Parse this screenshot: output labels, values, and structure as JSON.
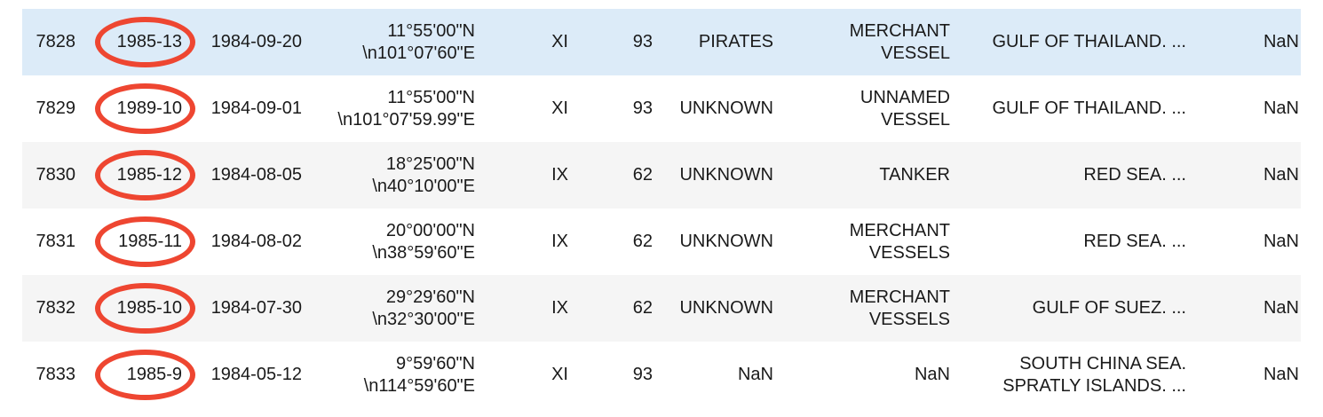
{
  "table": {
    "rows": [
      {
        "index": "7828",
        "reference": "1985-13",
        "date": "1984-09-20",
        "coord_lat": "11°55'00\"N",
        "coord_lon": "\\n101°07'60\"E",
        "subreg": "XI",
        "navarea": "93",
        "aggressor": "PIRATES",
        "victim_line1": "MERCHANT",
        "victim_line2": "VESSEL",
        "location_line1": "GULF OF THAILAND. ...",
        "location_line2": "",
        "last": "NaN"
      },
      {
        "index": "7829",
        "reference": "1989-10",
        "date": "1984-09-01",
        "coord_lat": "11°55'00\"N",
        "coord_lon": "\\n101°07'59.99\"E",
        "subreg": "XI",
        "navarea": "93",
        "aggressor": "UNKNOWN",
        "victim_line1": "UNNAMED",
        "victim_line2": "VESSEL",
        "location_line1": "GULF OF THAILAND. ...",
        "location_line2": "",
        "last": "NaN"
      },
      {
        "index": "7830",
        "reference": "1985-12",
        "date": "1984-08-05",
        "coord_lat": "18°25'00\"N",
        "coord_lon": "\\n40°10'00\"E",
        "subreg": "IX",
        "navarea": "62",
        "aggressor": "UNKNOWN",
        "victim_line1": "TANKER",
        "victim_line2": "",
        "location_line1": "RED SEA. ...",
        "location_line2": "",
        "last": "NaN"
      },
      {
        "index": "7831",
        "reference": "1985-11",
        "date": "1984-08-02",
        "coord_lat": "20°00'00\"N",
        "coord_lon": "\\n38°59'60\"E",
        "subreg": "IX",
        "navarea": "62",
        "aggressor": "UNKNOWN",
        "victim_line1": "MERCHANT",
        "victim_line2": "VESSELS",
        "location_line1": "RED SEA. ...",
        "location_line2": "",
        "last": "NaN"
      },
      {
        "index": "7832",
        "reference": "1985-10",
        "date": "1984-07-30",
        "coord_lat": "29°29'60\"N",
        "coord_lon": "\\n32°30'00\"E",
        "subreg": "IX",
        "navarea": "62",
        "aggressor": "UNKNOWN",
        "victim_line1": "MERCHANT",
        "victim_line2": "VESSELS",
        "location_line1": "GULF OF SUEZ. ...",
        "location_line2": "",
        "last": "NaN"
      },
      {
        "index": "7833",
        "reference": "1985-9",
        "date": "1984-05-12",
        "coord_lat": "9°59'60\"N",
        "coord_lon": "\\n114°59'60\"E",
        "subreg": "XI",
        "navarea": "93",
        "aggressor": "NaN",
        "victim_line1": "NaN",
        "victim_line2": "",
        "location_line1": "SOUTH CHINA SEA.",
        "location_line2": "SPRATLY ISLANDS. ...",
        "last": "NaN"
      }
    ]
  },
  "annotation": {
    "circle_color": "#ee4631",
    "highlight_color": "#dcebf8"
  }
}
